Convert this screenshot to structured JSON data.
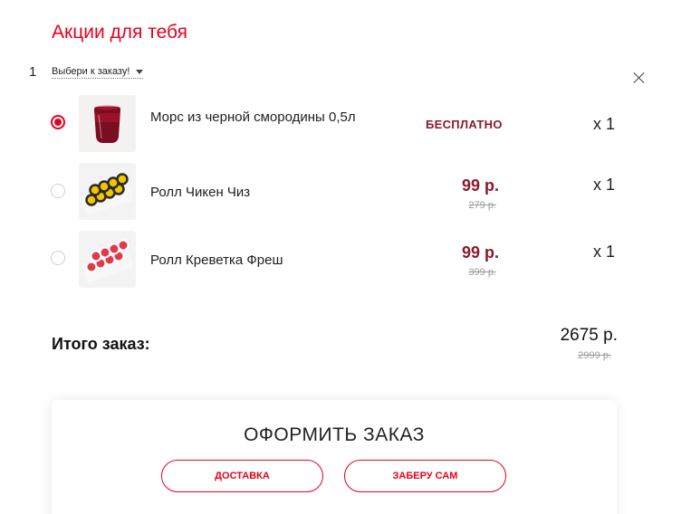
{
  "section_title": "Акции для тебя",
  "promo": {
    "number": "1",
    "select_label": "Выбери к заказу!"
  },
  "items": [
    {
      "name": "Морс из черной смородины 0,5л",
      "price_label": "БЕСПЛАТНО",
      "old_price": "",
      "quantity": "x 1",
      "selected": true,
      "image_icon": "berry-juice-glass"
    },
    {
      "name": "Ролл Чикен Чиз",
      "price_label": "99 р.",
      "old_price": "279 р.",
      "quantity": "x 1",
      "selected": false,
      "image_icon": "sushi-roll-yellow"
    },
    {
      "name": "Ролл Креветка Фреш",
      "price_label": "99 р.",
      "old_price": "399 р.",
      "quantity": "x 1",
      "selected": false,
      "image_icon": "sushi-roll-red"
    }
  ],
  "total": {
    "label": "Итого заказ:",
    "value": "2675 р.",
    "old_value": "2999 р."
  },
  "checkout": {
    "title": "ОФОРМИТЬ ЗАКАЗ",
    "delivery_label": "ДОСТАВКА",
    "pickup_label": "ЗАБЕРУ САМ"
  },
  "colors": {
    "accent": "#e8001c",
    "price": "#8b1a2b"
  }
}
